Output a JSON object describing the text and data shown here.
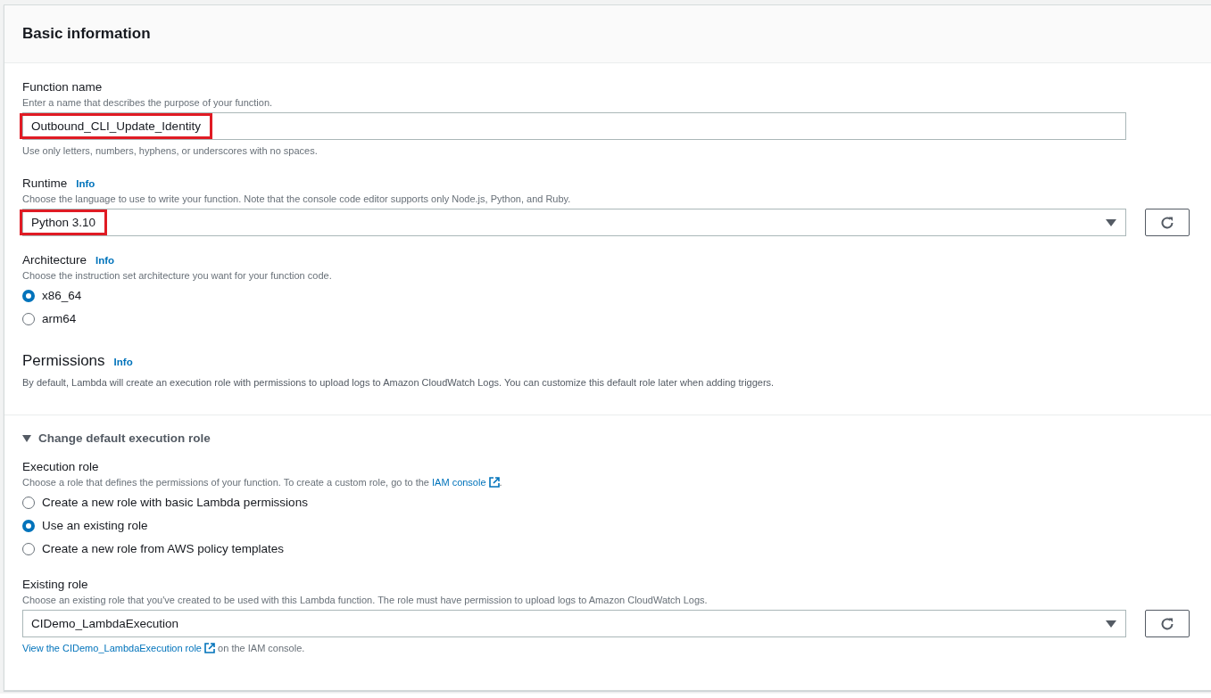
{
  "panel": {
    "title": "Basic information"
  },
  "function_name": {
    "label": "Function name",
    "help": "Enter a name that describes the purpose of your function.",
    "value": "Outbound_CLI_Update_Identity",
    "highlighted": true,
    "constraint": "Use only letters, numbers, hyphens, or underscores with no spaces."
  },
  "runtime": {
    "label": "Runtime",
    "info": "Info",
    "help": "Choose the language to use to write your function. Note that the console code editor supports only Node.js, Python, and Ruby.",
    "value": "Python 3.10",
    "highlighted": true
  },
  "architecture": {
    "label": "Architecture",
    "info": "Info",
    "help": "Choose the instruction set architecture you want for your function code.",
    "options": [
      {
        "label": "x86_64",
        "selected": true
      },
      {
        "label": "arm64",
        "selected": false
      }
    ]
  },
  "permissions": {
    "title": "Permissions",
    "info": "Info",
    "text": "By default, Lambda will create an execution role with permissions to upload logs to Amazon CloudWatch Logs. You can customize this default role later when adding triggers."
  },
  "execution_role_section": {
    "title": "Change default execution role",
    "expanded": true,
    "execution_role": {
      "label": "Execution role",
      "help": "Choose a role that defines the permissions of your function. To create a custom role, go to the",
      "link": "IAM console",
      "help_end": ".",
      "options": [
        {
          "label": "Create a new role with basic Lambda permissions",
          "selected": false
        },
        {
          "label": "Use an existing role",
          "selected": true
        },
        {
          "label": "Create a new role from AWS policy templates",
          "selected": false
        }
      ]
    },
    "existing_role": {
      "label": "Existing role",
      "help": "Choose an existing role that you've created to be used with this Lambda function. The role must have permission to upload logs to Amazon CloudWatch Logs.",
      "value": "CIDemo_LambdaExecution",
      "highlighted": false,
      "link": "View the CIDemo_LambdaExecution role",
      "link_end": "on the IAM console."
    }
  }
}
